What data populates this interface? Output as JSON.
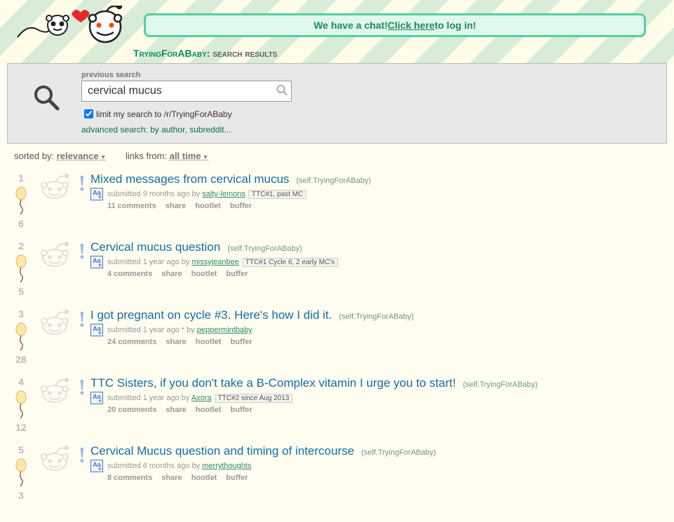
{
  "header": {
    "chat_prefix": "We have a chat! ",
    "chat_link": "Click here",
    "chat_suffix": " to log in!",
    "subreddit": "TryingForABaby",
    "subtitle_suffix": ": search results"
  },
  "search": {
    "label_previous": "previous search",
    "value": "cervical mucus",
    "limit_label": "limit my search to /r/TryingForABaby",
    "advanced_label": "advanced search: by author, subreddit..."
  },
  "sort": {
    "sorted_by_label": "sorted by: ",
    "sorted_by_value": "relevance",
    "links_from_label": "links from: ",
    "links_from_value": "all time"
  },
  "btn": {
    "share": "share",
    "hootlet": "hootlet",
    "buffer": "buffer"
  },
  "posts": [
    {
      "rank": "1",
      "score": "6",
      "title": "Mixed messages from cervical mucus",
      "sub": "(self.TryingForABaby)",
      "age": "submitted 9 months ago by ",
      "author": "salty-lemons",
      "flair": "TTC#1, past MC",
      "comments": "11 comments"
    },
    {
      "rank": "2",
      "score": "5",
      "title": "Cervical mucus question",
      "sub": "(self.TryingForABaby)",
      "age": "submitted 1 year ago by ",
      "author": "missyjeanbee",
      "flair": "TTC#1 Cycle 6, 2 early MC's",
      "comments": "4 comments"
    },
    {
      "rank": "3",
      "score": "28",
      "title": "I got pregnant on cycle #3. Here's how I did it.",
      "sub": "(self.TryingForABaby)",
      "age": "submitted 1 year ago * by ",
      "author": "peppermintbaby",
      "flair": "",
      "comments": "24 comments"
    },
    {
      "rank": "4",
      "score": "12",
      "title": "TTC Sisters, if you don't take a B-Complex vitamin I urge you to start!",
      "sub": "(self.TryingForABaby)",
      "age": "submitted 1 year ago by ",
      "author": "Axora",
      "flair": "TTC#2 since Aug 2013",
      "comments": "20 comments"
    },
    {
      "rank": "5",
      "score": "3",
      "title": "Cervical Mucus question and timing of intercourse",
      "sub": "(self.TryingForABaby)",
      "age": "submitted 6 months ago by ",
      "author": "merrythoughts",
      "flair": "",
      "comments": "8 comments"
    }
  ]
}
